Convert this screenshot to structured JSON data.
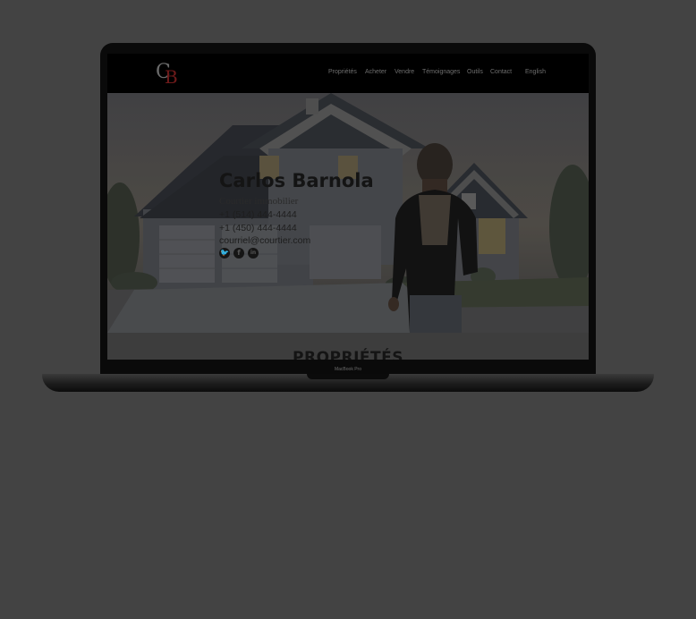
{
  "site": {
    "logo": {
      "letter1": "C",
      "letter2": "B"
    },
    "nav": [
      "Propriétés",
      "Acheter",
      "Vendre",
      "Témoignages",
      "Outils",
      "Contact"
    ],
    "language": "English"
  },
  "hero": {
    "name": "Carlos Barnola",
    "title": "Courtier immobilier",
    "phone1": "+1 (514) 444-4444",
    "phone2": "+1 (450) 444-4444",
    "email": "courriel@courtier.com",
    "social_icons": [
      "twitter-icon",
      "facebook-icon",
      "linkedin-icon"
    ]
  },
  "section": {
    "title": "PROPRIÉTÉS"
  },
  "device": {
    "label": "MacBook Pro"
  },
  "colors": {
    "background": "#434343",
    "header": "#000000",
    "logo_accent": "#6e1a1a"
  }
}
